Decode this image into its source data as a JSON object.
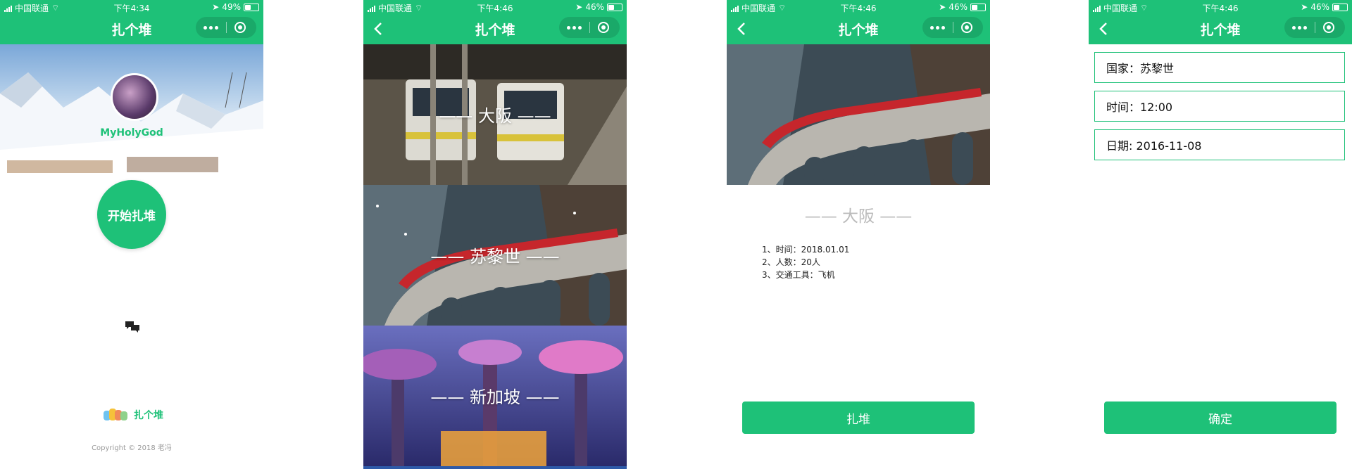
{
  "colors": {
    "brand": "#1ec178",
    "secondary_text": "#bbbbbb"
  },
  "screens": [
    {
      "status": {
        "carrier": "中国联通",
        "time": "下午4:34",
        "battery": "49%"
      },
      "title": "扎个堆",
      "profile": {
        "username": "MyHolyGod"
      },
      "start_button": "开始扎堆",
      "chat_icon": "chat-bubbles-icon",
      "footer": {
        "logo_text": "扎个堆",
        "copyright": "Copyright © 2018 老冯"
      }
    },
    {
      "status": {
        "carrier": "中国联通",
        "time": "下午4:46",
        "battery": "46%"
      },
      "title": "扎个堆",
      "cities": [
        {
          "label": "—— 大阪 ——"
        },
        {
          "label": "—— 苏黎世 ——"
        },
        {
          "label": "—— 新加坡 ——"
        }
      ]
    },
    {
      "status": {
        "carrier": "中国联通",
        "time": "下午4:46",
        "battery": "46%"
      },
      "title": "扎个堆",
      "heading": "—— 大阪 ——",
      "details": [
        "1、时间：2018.01.01",
        "2、人数：20人",
        "3、交通工具：飞机"
      ],
      "button": "扎堆"
    },
    {
      "status": {
        "carrier": "中国联通",
        "time": "下午4:46",
        "battery": "46%"
      },
      "title": "扎个堆",
      "fields": [
        "国家：苏黎世",
        "时间：12:00",
        "日期: 2016-11-08"
      ],
      "button": "确定"
    }
  ]
}
